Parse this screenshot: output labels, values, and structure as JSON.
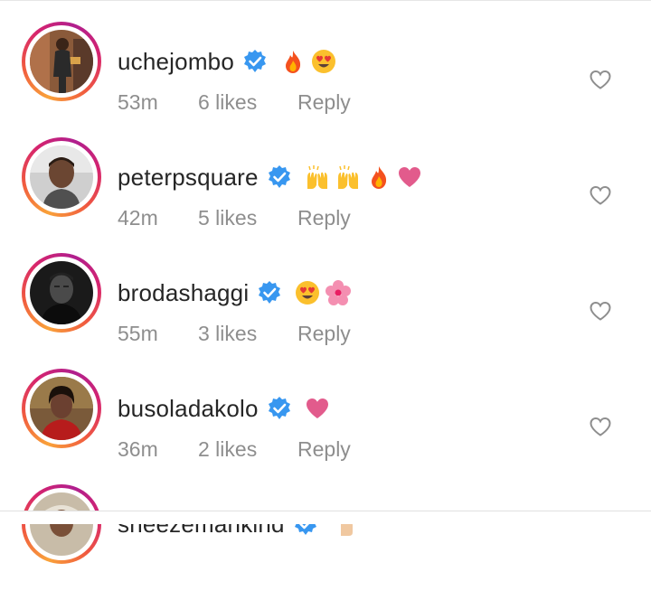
{
  "comments": [
    {
      "username": "uchejombo",
      "verified": true,
      "emojis": [
        "fire-emoji",
        "heart-eyes-emoji"
      ],
      "time": "53m",
      "likes": "6 likes",
      "reply": "Reply"
    },
    {
      "username": "peterpsquare",
      "verified": true,
      "emojis": [
        "raising-hands-emoji",
        "raising-hands-emoji",
        "fire-emoji",
        "pink-heart-emoji"
      ],
      "time": "42m",
      "likes": "5 likes",
      "reply": "Reply"
    },
    {
      "username": "brodashaggi",
      "verified": true,
      "emojis": [
        "heart-eyes-emoji",
        "cherry-blossom-emoji"
      ],
      "time": "55m",
      "likes": "3 likes",
      "reply": "Reply"
    },
    {
      "username": "busoladakolo",
      "verified": true,
      "emojis": [
        "pink-heart-emoji"
      ],
      "time": "36m",
      "likes": "2 likes",
      "reply": "Reply"
    },
    {
      "username": "sneezemankind",
      "verified": true,
      "emojis": [
        "pointing-up-emoji"
      ]
    }
  ],
  "colors": {
    "verified_badge": "#3897f0",
    "meta_text": "#8e8e8e",
    "username_text": "#262626",
    "heart_icon": "#8e8e8e"
  }
}
